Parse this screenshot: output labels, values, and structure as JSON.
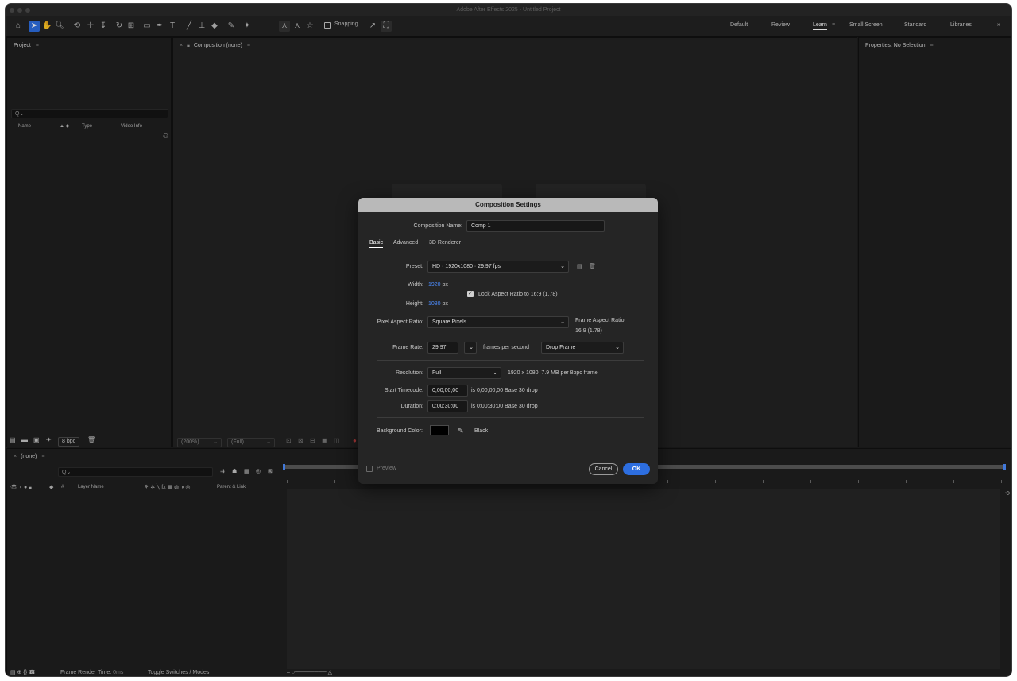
{
  "window": {
    "title": "Adobe After Effects 2025 - Untitled Project"
  },
  "toolbar": {
    "snapping_label": "Snapping",
    "tools": [
      "home-icon",
      "selection-icon",
      "hand-icon",
      "zoom-icon",
      "orbit-icon",
      "pan-icon",
      "dolly-icon",
      "rotate-icon",
      "anchor-icon",
      "shape-icon",
      "pen-icon",
      "type-icon",
      "brush-icon",
      "clone-stamp-icon",
      "eraser-icon",
      "roto-brush-icon",
      "puppet-icon"
    ]
  },
  "workspaces": {
    "items": [
      "Default",
      "Review",
      "Learn",
      "Small Screen",
      "Standard",
      "Libraries"
    ],
    "active": "Learn",
    "more": "»"
  },
  "project": {
    "title": "Project",
    "columns": {
      "name": "Name",
      "type": "Type",
      "video_info": "Video Info"
    },
    "bpc": "8 bpc"
  },
  "composition": {
    "title": "Composition (none)",
    "zoom": "(200%)",
    "resolution": "(Full)"
  },
  "properties": {
    "title": "Properties: No Selection"
  },
  "timeline": {
    "title": "(none)",
    "columns": {
      "number": "#",
      "layer_name": "Layer Name",
      "parent": "Parent & Link"
    },
    "frame_render_label": "Frame Render Time:",
    "frame_render_value": "0ms",
    "toggle_label": "Toggle Switches / Modes"
  },
  "dialog": {
    "title": "Composition Settings",
    "comp_name_label": "Composition Name:",
    "comp_name": "Comp 1",
    "tabs": [
      "Basic",
      "Advanced",
      "3D Renderer"
    ],
    "preset_label": "Preset:",
    "preset": "HD · 1920x1080 · 29.97 fps",
    "width_label": "Width:",
    "width": "1920",
    "height_label": "Height:",
    "height": "1080",
    "unit": "px",
    "lock_label": "Lock Aspect Ratio to 16:9 (1.78)",
    "lock_checked": true,
    "par_label": "Pixel Aspect Ratio:",
    "par": "Square Pixels",
    "far_label": "Frame Aspect Ratio:",
    "far_value": "16:9 (1.78)",
    "fps_label": "Frame Rate:",
    "fps": "29.97",
    "fps_unit": "frames per second",
    "drop_frame": "Drop Frame",
    "res_label": "Resolution:",
    "res": "Full",
    "res_info": "1920 x 1080, 7.9 MB per 8bpc frame",
    "start_label": "Start Timecode:",
    "start": "0;00;00;00",
    "start_info": "is 0;00;00;00  Base 30   drop",
    "dur_label": "Duration:",
    "dur": "0;00;30;00",
    "dur_info": "is 0;00;30;00  Base 30   drop",
    "bg_label": "Background Color:",
    "bg_name": "Black",
    "bg_color": "#000000",
    "preview_label": "Preview",
    "cancel": "Cancel",
    "ok": "OK"
  },
  "colors": {
    "accent": "#2d6ee0",
    "link_blue": "#4d8dff"
  }
}
